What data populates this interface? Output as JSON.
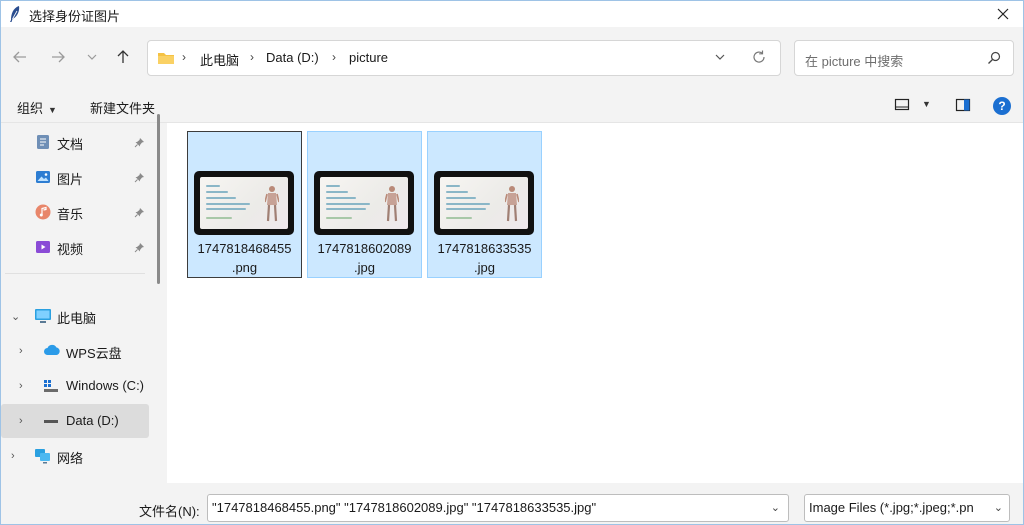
{
  "window": {
    "title": "选择身份证图片"
  },
  "address": {
    "crumbs": [
      "此电脑",
      "Data (D:)",
      "picture"
    ],
    "separator": "›"
  },
  "search": {
    "placeholder": "在 picture 中搜索"
  },
  "toolbar": {
    "organize": "组织",
    "new_folder": "新建文件夹",
    "help": "?"
  },
  "sidebar": {
    "quick_access": [
      {
        "label": "文档",
        "icon": "documents-icon"
      },
      {
        "label": "图片",
        "icon": "pictures-icon"
      },
      {
        "label": "音乐",
        "icon": "music-icon"
      },
      {
        "label": "视频",
        "icon": "videos-icon"
      }
    ],
    "this_pc": "此电脑",
    "drives": [
      {
        "label": "WPS云盘",
        "icon": "cloud-icon"
      },
      {
        "label": "Windows (C:)",
        "icon": "windows-drive-icon"
      },
      {
        "label": "Data (D:)",
        "icon": "drive-icon"
      }
    ],
    "network": "网络"
  },
  "files": [
    {
      "name_line1": "1747818468455",
      "name_line2": ".png"
    },
    {
      "name_line1": "1747818602089",
      "name_line2": ".jpg"
    },
    {
      "name_line1": "1747818633535",
      "name_line2": ".jpg"
    }
  ],
  "footer": {
    "filename_label": "文件名(N):",
    "filename_value": "\"1747818468455.png\" \"1747818602089.jpg\" \"1747818633535.jpg\"",
    "filetype": "Image Files (*.jpg;*.jpeg;*.pn"
  },
  "colors": {
    "accent": "#1b6fd1",
    "selection": "#cce8ff",
    "selection_border": "#99d1ff"
  }
}
